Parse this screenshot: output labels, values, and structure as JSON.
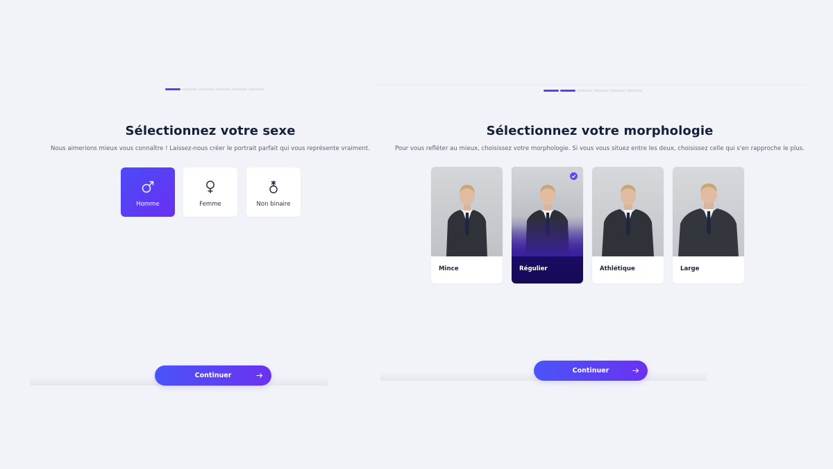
{
  "steps_left": {
    "total": 6,
    "active": 1
  },
  "steps_right": {
    "total": 6,
    "active": 2
  },
  "gender_screen": {
    "title": "Sélectionnez votre sexe",
    "subtitle": "Nous aimerions mieux vous connaître ! Laissez-nous créer le portrait parfait qui vous représente vraiment.",
    "options": [
      {
        "label": "Homme",
        "icon": "male-icon",
        "selected": true
      },
      {
        "label": "Femme",
        "icon": "female-icon",
        "selected": false
      },
      {
        "label": "Non binaire",
        "icon": "nonbinary-icon",
        "selected": false
      }
    ],
    "continue_label": "Continuer"
  },
  "morphology_screen": {
    "title": "Sélectionnez votre morphologie",
    "subtitle": "Pour vous refléter au mieux, choisissez votre morphologie. Si vous vous situez entre les deux, choisissez celle qui s'en rapproche le plus.",
    "options": [
      {
        "label": "Mince",
        "selected": false
      },
      {
        "label": "Régulier",
        "selected": true
      },
      {
        "label": "Athlétique",
        "selected": false
      },
      {
        "label": "Large",
        "selected": false
      }
    ],
    "continue_label": "Continuer"
  },
  "colors": {
    "accent": "#5b3ff0",
    "gradient_start": "#4a54f8",
    "gradient_end": "#6a32f0",
    "background": "#f2f3f8"
  }
}
